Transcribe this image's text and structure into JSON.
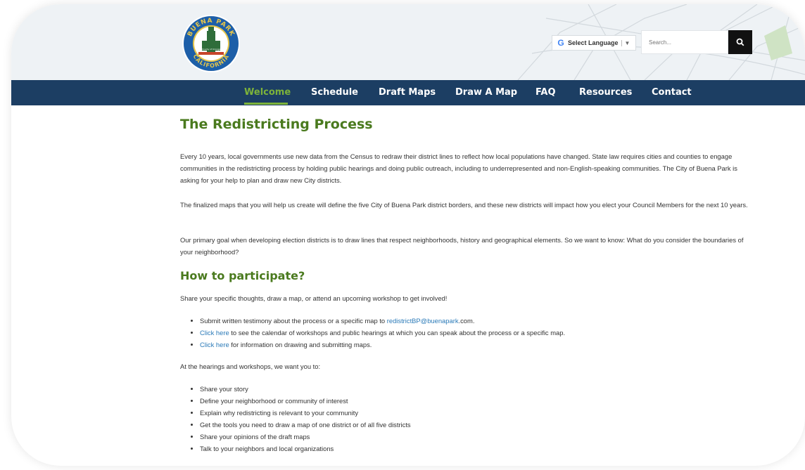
{
  "header": {
    "logo_text_top": "BUENA PARK",
    "logo_text_bottom": "CALIFORNIA",
    "logo_small_text": "County of Orange",
    "language": {
      "g_letter": "G",
      "label": "Select Language",
      "caret": "▼"
    },
    "search": {
      "placeholder": "Search..."
    }
  },
  "nav": {
    "items": [
      {
        "label": "Welcome"
      },
      {
        "label": "Schedule"
      },
      {
        "label": "Draft Maps"
      },
      {
        "label": "Draw A Map"
      },
      {
        "label": "FAQ"
      },
      {
        "label": "Resources"
      },
      {
        "label": "Contact"
      }
    ]
  },
  "page": {
    "title": "The Redistricting Process",
    "p1": "Every 10 years, local governments use new data from the Census to redraw their district lines to reflect how local populations have changed. State law requires cities and counties to engage communities in the redistricting process by holding public hearings and doing public outreach, including to underrepresented and non-English-speaking communities. The City of Buena Park is asking for your help to plan and draw new City districts.",
    "p2": "The finalized maps that you will help us create will define the five City of Buena Park district borders, and these new districts will impact how you elect your Council Members for the next 10 years.",
    "p3": "Our primary goal when developing election districts is to draw lines that respect neighborhoods, history and geographical elements. So we want to know: What do you consider the boundaries of your neighborhood?",
    "h2": "How to participate?",
    "intro": "Share your specific thoughts, draw a map, or attend an upcoming workshop to get involved!",
    "participate": {
      "item1_text": "Submit written testimony about the process or a specific map to ",
      "item1_link": "redistrictBP@buenapark",
      "item1_tail": ".com.",
      "item2_link": "Click here",
      "item2_text": " to see the calendar of workshops and public hearings at which you can speak about the process or a specific map.",
      "item3_link": "Click here",
      "item3_text": " for information on drawing and submitting maps."
    },
    "hearings_intro": "At the hearings and workshops, we want you to:",
    "hearings_list": [
      "Share your story",
      "Define your neighborhood or community of interest",
      "Explain why redistricting is relevant to your community",
      "Get the tools you need to draw a map of one district or of all five districts",
      "Share your opinions of the draft maps",
      "Talk to your neighbors and local organizations"
    ]
  },
  "colors": {
    "nav_bg": "#1c3e63",
    "accent_green": "#7db33a",
    "heading_green": "#4a7a1e",
    "link_blue": "#2a7ab8"
  },
  "icons": {
    "search": "search-icon",
    "logo": "city-seal-logo"
  }
}
